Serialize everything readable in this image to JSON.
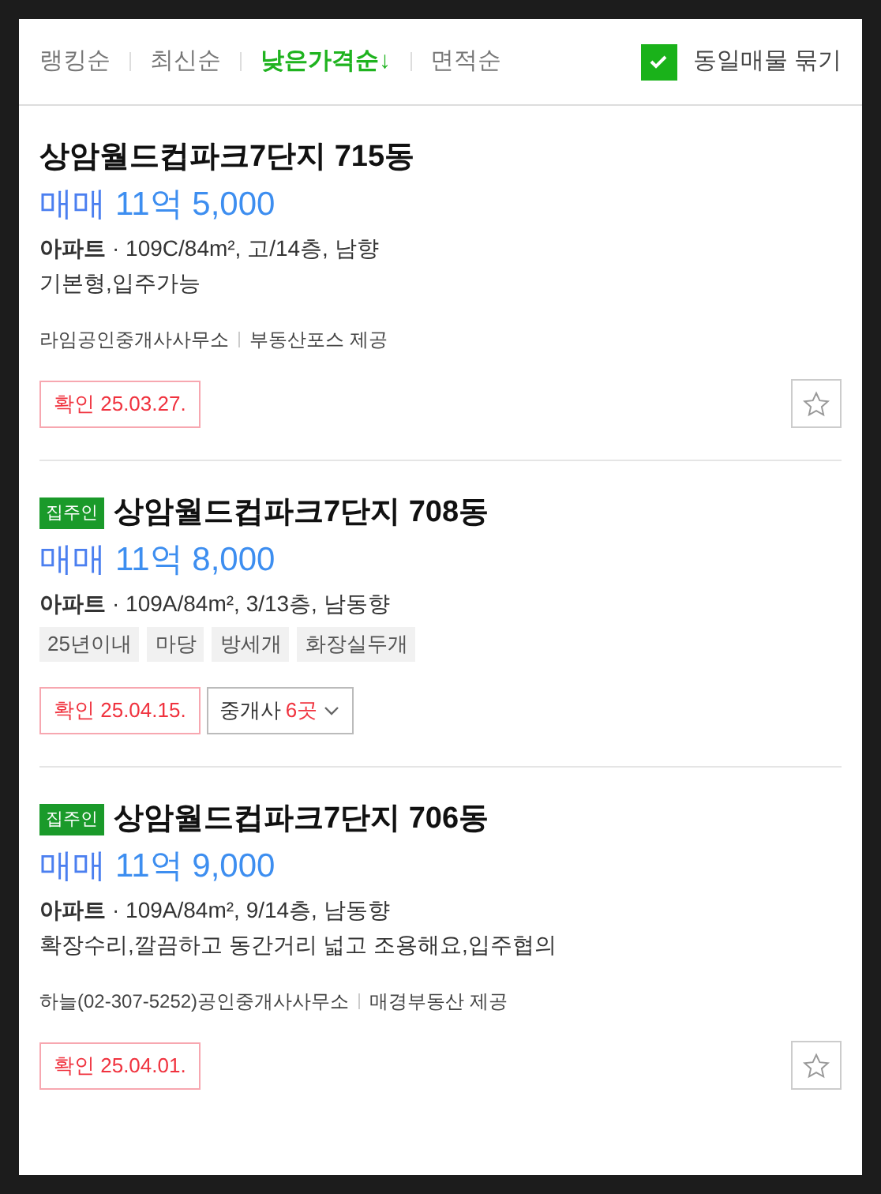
{
  "sort_options": [
    {
      "label": "랭킹순",
      "selected": false
    },
    {
      "label": "최신순",
      "selected": false
    },
    {
      "label": "낮은가격순↓",
      "selected": true
    },
    {
      "label": "면적순",
      "selected": false
    }
  ],
  "group_toggle": {
    "label": "동일매물 묶기",
    "checked": true
  },
  "listings": [
    {
      "title": "상암월드컵파크7단지 715동",
      "price_type": "매매",
      "price": "11억 5,000",
      "property_type": "아파트",
      "spec": "· 109C/84m², 고/14층, 남향",
      "description": "기본형,입주가능",
      "agency": "라임공인중개사사무소",
      "provider": "부동산포스 제공",
      "verified": "확인 25.03.27.",
      "favorite": {
        "selected": false
      }
    },
    {
      "owner_badge": "집주인",
      "title": "상암월드컵파크7단지 708동",
      "price_type": "매매",
      "price": "11억 8,000",
      "property_type": "아파트",
      "spec": "· 109A/84m², 3/13층, 남동향",
      "tags": [
        "25년이내",
        "마당",
        "방세개",
        "화장실두개"
      ],
      "verified": "확인 25.04.15.",
      "brokers": {
        "label": "중개사",
        "count": "6곳"
      }
    },
    {
      "owner_badge": "집주인",
      "title": "상암월드컵파크7단지 706동",
      "price_type": "매매",
      "price": "11억 9,000",
      "property_type": "아파트",
      "spec": "· 109A/84m², 9/14층, 남동향",
      "description": "확장수리,깔끔하고 동간거리 넓고 조용해요,입주협의",
      "agency": "하늘(02-307-5252)공인중개사사무소",
      "provider": "매경부동산 제공",
      "verified": "확인 25.04.01.",
      "favorite": {
        "selected": false
      }
    }
  ]
}
